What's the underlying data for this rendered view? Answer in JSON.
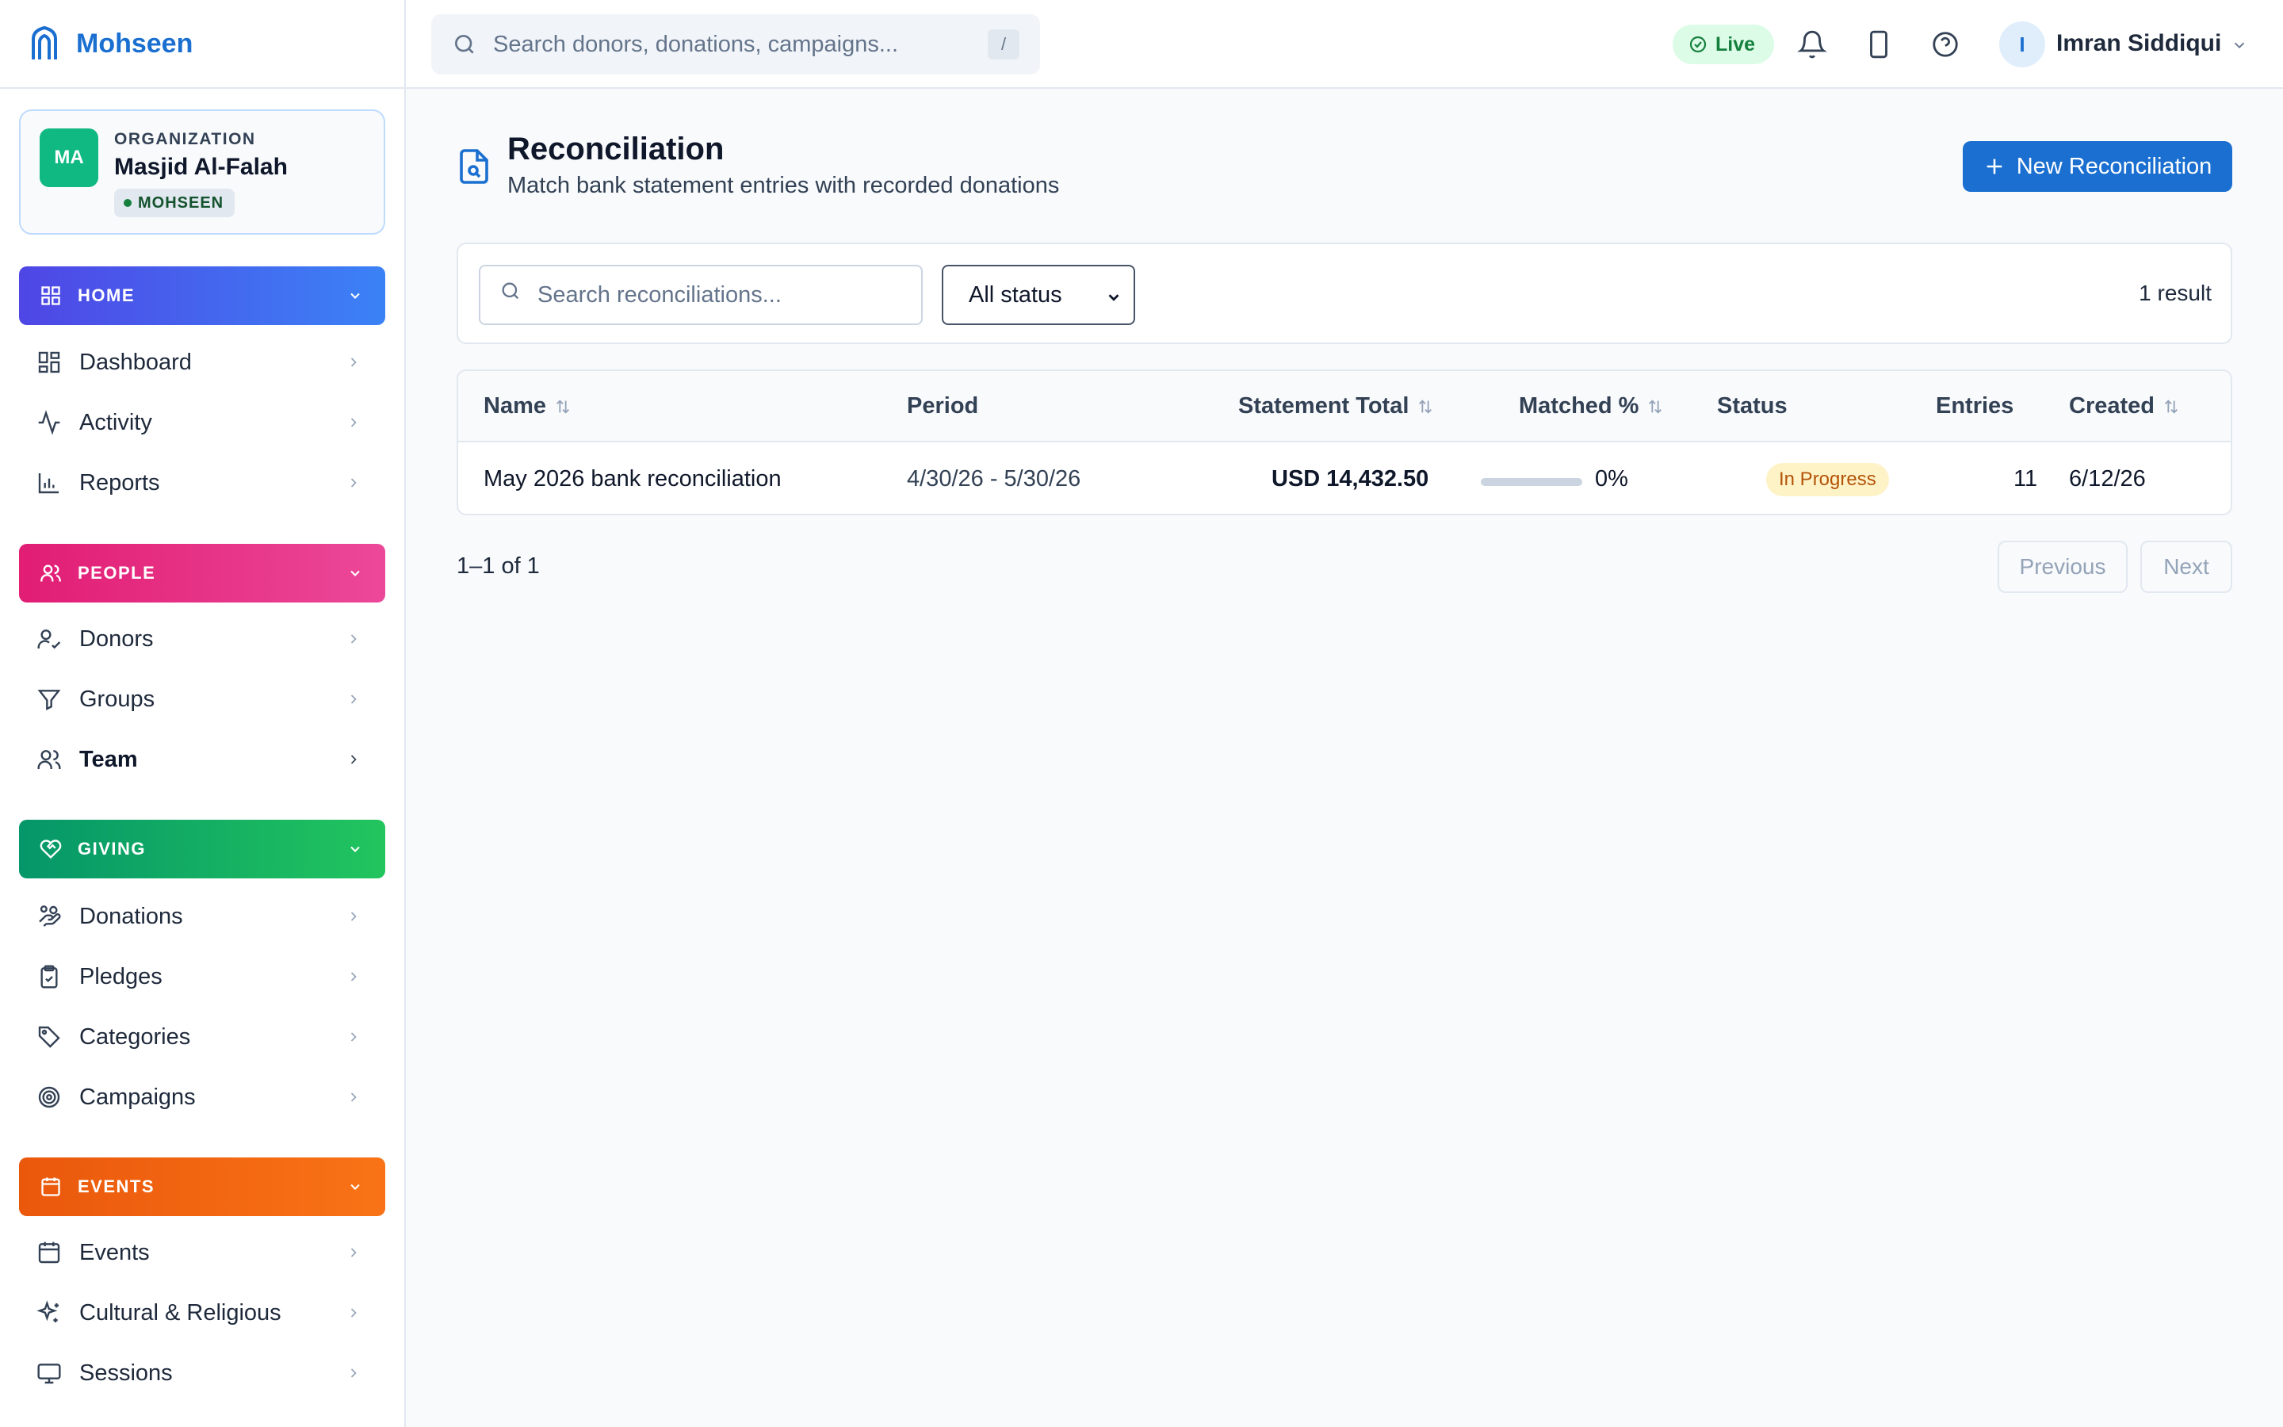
{
  "brand": {
    "name": "Mohseen"
  },
  "organization": {
    "label": "ORGANIZATION",
    "name": "Masjid Al-Falah",
    "initials": "MA",
    "badge": "MOHSEEN"
  },
  "sidebar": {
    "sections": [
      {
        "title": "HOME",
        "color_from": "#4f46e5",
        "color_to": "#3b82f6",
        "items": [
          "Dashboard",
          "Activity",
          "Reports"
        ]
      },
      {
        "title": "PEOPLE",
        "color_from": "#e11d74",
        "color_to": "#ec4899",
        "items": [
          "Donors",
          "Groups",
          "Team"
        ]
      },
      {
        "title": "GIVING",
        "color_from": "#059669",
        "color_to": "#22c55e",
        "items": [
          "Donations",
          "Pledges",
          "Categories",
          "Campaigns"
        ]
      },
      {
        "title": "EVENTS",
        "color_from": "#ea580c",
        "color_to": "#f97316",
        "items": [
          "Events",
          "Cultural & Religious",
          "Sessions"
        ]
      }
    ]
  },
  "topbar": {
    "search_placeholder": "Search donors, donations, campaigns...",
    "shortcut": "/",
    "live_label": "Live",
    "user_initial": "I",
    "user_name": "Imran Siddiqui"
  },
  "page": {
    "title": "Reconciliation",
    "subtitle": "Match bank statement entries with recorded donations",
    "new_button": "New Reconciliation"
  },
  "filters": {
    "search_placeholder": "Search reconciliations...",
    "status_value": "All status",
    "result_count": "1 result"
  },
  "table": {
    "columns": {
      "name": "Name",
      "period": "Period",
      "statement_total": "Statement Total",
      "matched": "Matched %",
      "status": "Status",
      "entries": "Entries",
      "created": "Created"
    },
    "rows": [
      {
        "name": "May 2026 bank reconciliation",
        "period": "4/30/26 - 5/30/26",
        "statement_total": "USD 14,432.50",
        "matched_percent": "0%",
        "matched_fraction": 0,
        "status": "In Progress",
        "entries": "11",
        "created": "6/12/26"
      }
    ]
  },
  "pagination": {
    "range": "1–1 of 1",
    "previous": "Previous",
    "next": "Next"
  }
}
